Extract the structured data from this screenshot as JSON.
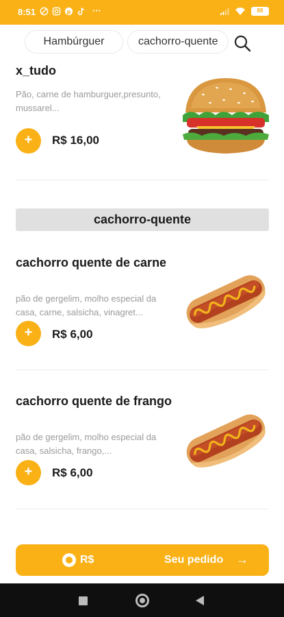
{
  "status_bar": {
    "time": "8:51",
    "more": "···",
    "battery": "88",
    "icons": [
      "no-disturb-icon",
      "instagram-icon",
      "pinterest-icon",
      "tiktok-icon",
      "signal-icon",
      "wifi-icon",
      "battery-icon"
    ]
  },
  "tabs": [
    "Hambúrguer",
    "cachorro-quente"
  ],
  "theme": {
    "accent": "#f9b116",
    "section_bg": "#e0e0e0"
  },
  "items": [
    {
      "name": "x_tudo",
      "description": "Pão, carne de hamburguer,presunto, mussarel...",
      "price": "R$ 16,00",
      "add": "+",
      "image": "burger-image"
    },
    {
      "name": "cachorro quente de carne",
      "description": "pão de gergelim, molho especial da casa, carne, salsicha, vinagret...",
      "price": "R$ 6,00",
      "add": "+",
      "image": "hotdog-image"
    },
    {
      "name": "cachorro quente de frango",
      "description": "pão de gergelim, molho especial da casa, salsicha, frango,...",
      "price": "R$ 6,00",
      "add": "+",
      "image": "hotdog-image"
    }
  ],
  "section": {
    "title": "cachorro-quente"
  },
  "order_bar": {
    "total": "R$",
    "label": "Seu pedido",
    "arrow": "→"
  }
}
